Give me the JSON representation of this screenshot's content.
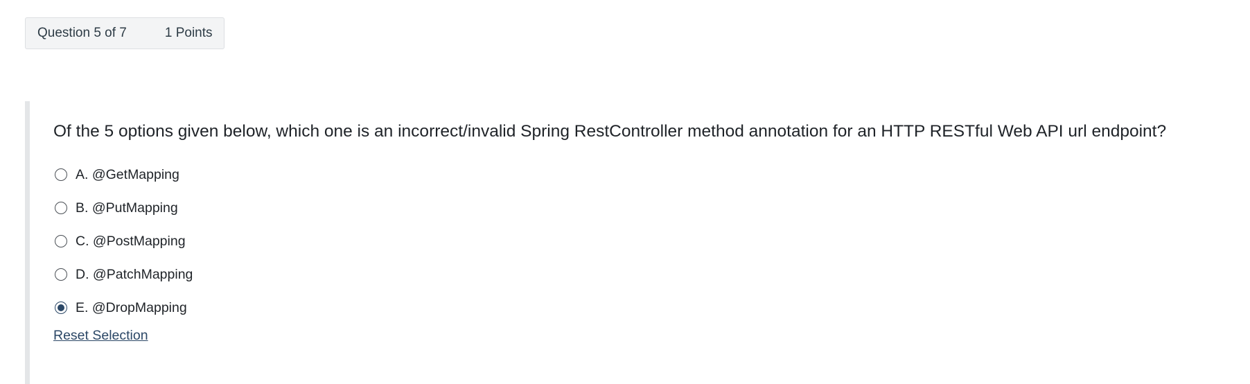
{
  "header": {
    "question_number": "Question 5 of 7",
    "points": "1 Points"
  },
  "question": {
    "text": "Of the 5 options given below, which one is an incorrect/invalid Spring RestController method annotation for an HTTP RESTful Web API url endpoint?",
    "options": [
      {
        "label": "A. @GetMapping",
        "selected": false
      },
      {
        "label": "B. @PutMapping",
        "selected": false
      },
      {
        "label": "C. @PostMapping",
        "selected": false
      },
      {
        "label": "D. @PatchMapping",
        "selected": false
      },
      {
        "label": "E. @DropMapping",
        "selected": true
      }
    ],
    "reset_label": "Reset Selection"
  },
  "colors": {
    "accent": "#2b4766",
    "header_bg": "#f3f4f5",
    "panel_border": "#e4e6e8"
  }
}
